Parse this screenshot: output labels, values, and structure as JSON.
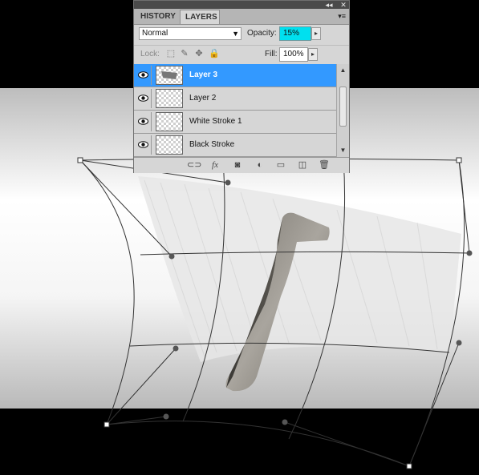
{
  "panel": {
    "collapse_glyph": "◂◂",
    "close_glyph": "✕",
    "tabs": [
      {
        "label": "HISTORY",
        "active": false
      },
      {
        "label": "LAYERS",
        "active": true
      }
    ],
    "menu_glyph": "▾≡",
    "blend_mode": "Normal",
    "opacity_label": "Opacity:",
    "opacity_value": "15%",
    "lock_label": "Lock:",
    "fill_label": "Fill:",
    "fill_value": "100%",
    "layers": [
      {
        "name": "Layer 3",
        "selected": true
      },
      {
        "name": "Layer 2",
        "selected": false
      },
      {
        "name": "White Stroke 1",
        "selected": false
      },
      {
        "name": "Black Stroke",
        "selected": false
      }
    ],
    "bottom_icons": [
      "link-icon",
      "fx-icon",
      "mask-icon",
      "adjustment-icon",
      "group-icon",
      "new-layer-icon",
      "trash-icon"
    ]
  },
  "colors": {
    "selected_layer": "#3399ff",
    "opacity_highlight": "#00e0ef",
    "panel_bg": "#d6d6d6",
    "canvas_band": "#ececec"
  }
}
